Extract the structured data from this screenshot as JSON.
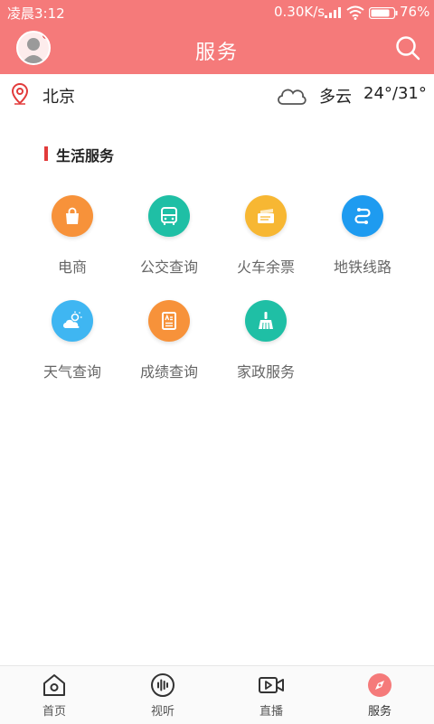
{
  "status_bar": {
    "time": "凌晨3:12",
    "network_speed": "0.30K/s",
    "battery": "76%"
  },
  "header": {
    "title": "服务"
  },
  "location": {
    "city": "北京",
    "weather": "多云",
    "temperature": "24°/31°"
  },
  "section": {
    "title": "生活服务"
  },
  "services": [
    {
      "label": "电商",
      "color": "#f7923a",
      "icon": "shopping-bag-icon"
    },
    {
      "label": "公交查询",
      "color": "#1fbfa5",
      "icon": "bus-icon"
    },
    {
      "label": "火车余票",
      "color": "#f7b733",
      "icon": "ticket-icon"
    },
    {
      "label": "地铁线路",
      "color": "#1e9bf0",
      "icon": "subway-route-icon"
    },
    {
      "label": "天气查询",
      "color": "#3fb6f2",
      "icon": "weather-icon"
    },
    {
      "label": "成绩查询",
      "color": "#f7923a",
      "icon": "score-card-icon"
    },
    {
      "label": "家政服务",
      "color": "#1fbfa5",
      "icon": "broom-icon"
    }
  ],
  "tabs": [
    {
      "label": "首页",
      "icon": "home-icon"
    },
    {
      "label": "视听",
      "icon": "audio-wave-icon"
    },
    {
      "label": "直播",
      "icon": "video-camera-icon"
    },
    {
      "label": "服务",
      "icon": "compass-icon",
      "active": true
    }
  ],
  "colors": {
    "brand": "#f57a7a",
    "accent": "#e23b3b"
  }
}
